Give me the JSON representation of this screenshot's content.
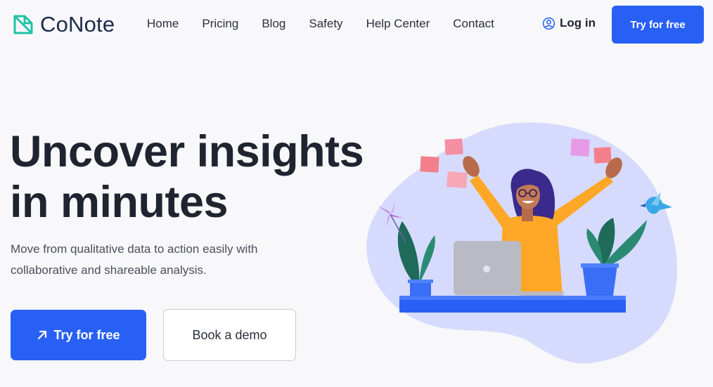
{
  "brand": {
    "name": "CoNote",
    "accent": "#2860f5",
    "logo_color": "#1fc2a6"
  },
  "nav": {
    "links": [
      "Home",
      "Pricing",
      "Blog",
      "Safety",
      "Help Center",
      "Contact"
    ],
    "login_label": "Log in",
    "login_icon": "user-circle-icon",
    "cta_label": "Try for free"
  },
  "hero": {
    "title_line1": "Uncover insights",
    "title_line2": "in minutes",
    "subtitle": "Move from qualitative data to action easily with collaborative and shareable analysis.",
    "primary_cta": "Try for free",
    "primary_cta_icon": "arrow-up-right-icon",
    "secondary_cta": "Book a demo"
  }
}
